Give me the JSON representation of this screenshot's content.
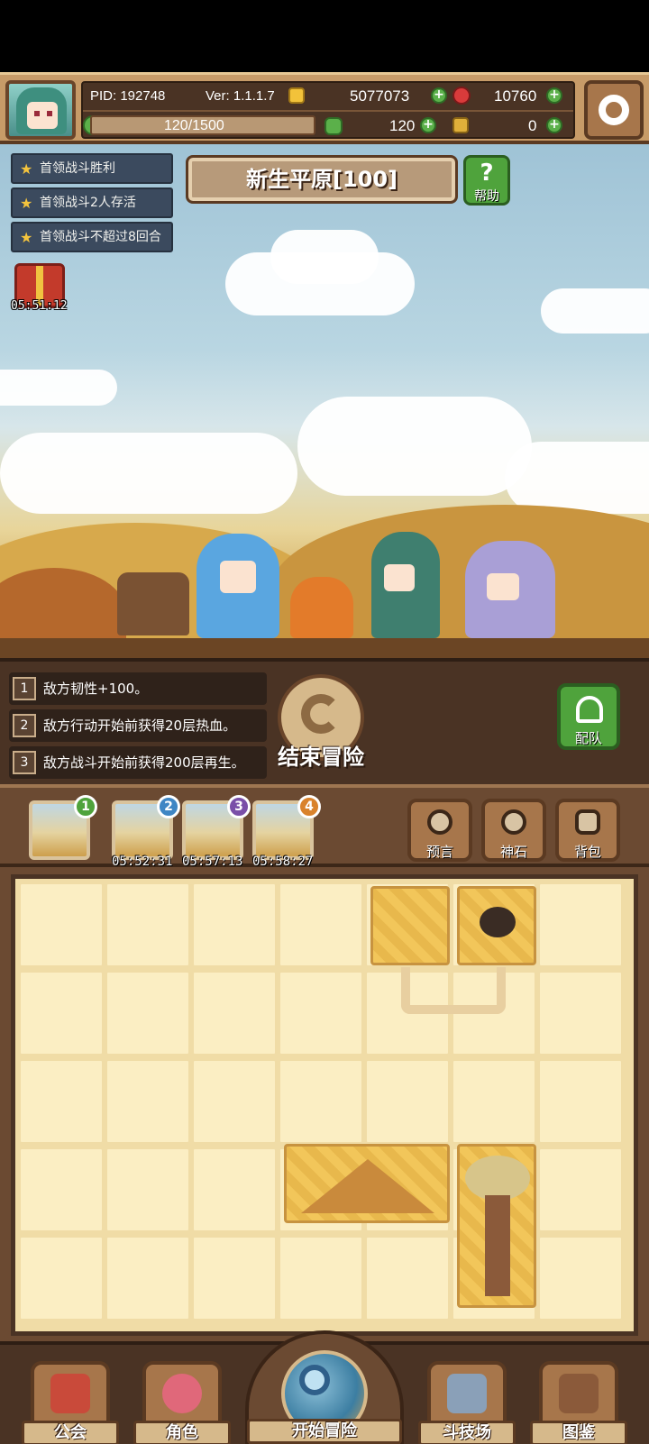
{
  "header": {
    "pid": "PID: 192748",
    "version": "Ver: 1.1.1.7",
    "gold": "5077073",
    "gems": "10760",
    "stamina": "120/1500",
    "clover": "120",
    "keys": "0"
  },
  "quests": [
    {
      "label": "首领战斗胜利"
    },
    {
      "label": "首领战斗2人存活"
    },
    {
      "label": "首领战斗不超过8回合"
    }
  ],
  "gift_timer": "05:51:12",
  "stage_title": "新生平原[100]",
  "help_label": "帮助",
  "effects": [
    {
      "num": "1",
      "text": "敌方韧性+100。"
    },
    {
      "num": "2",
      "text": "敌方行动开始前获得20层热血。"
    },
    {
      "num": "3",
      "text": "敌方战斗开始前获得200层再生。"
    }
  ],
  "end_adventure_label": "结束冒险",
  "team_label": "配队",
  "maps": [
    {
      "badge": "1",
      "timer": ""
    },
    {
      "badge": "2",
      "timer": "05:52:31"
    },
    {
      "badge": "3",
      "timer": "05:57:13"
    },
    {
      "badge": "4",
      "timer": "05:58:27"
    }
  ],
  "tools": {
    "prophecy": "预言",
    "godstone": "神石",
    "backpack": "背包"
  },
  "nav": {
    "guild": "公会",
    "character": "角色",
    "start": "开始冒险",
    "arena": "斗技场",
    "codex": "图鉴"
  },
  "colors": {
    "badge1": "#4fa33c",
    "badge2": "#3f86c4",
    "badge3": "#7a4fa8",
    "badge4": "#d9822b"
  }
}
